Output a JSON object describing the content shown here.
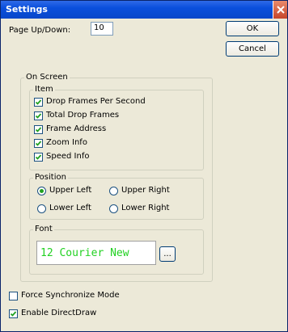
{
  "window": {
    "title": "Settings"
  },
  "page_updown": {
    "label": "Page Up/Down:",
    "value": "10"
  },
  "buttons": {
    "ok": "OK",
    "cancel": "Cancel",
    "font_browse": "..."
  },
  "on_screen": {
    "title": "On Screen",
    "item": {
      "title": "Item",
      "checkboxes": [
        {
          "label": "Drop Frames Per Second",
          "checked": true
        },
        {
          "label": "Total Drop Frames",
          "checked": true
        },
        {
          "label": "Frame Address",
          "checked": true
        },
        {
          "label": "Zoom Info",
          "checked": true
        },
        {
          "label": "Speed Info",
          "checked": true
        }
      ]
    },
    "position": {
      "title": "Position",
      "options": [
        {
          "label": "Upper Left",
          "selected": true
        },
        {
          "label": "Upper Right",
          "selected": false
        },
        {
          "label": "Lower Left",
          "selected": false
        },
        {
          "label": "Lower Right",
          "selected": false
        }
      ]
    },
    "font": {
      "title": "Font",
      "preview": "12 Courier New",
      "preview_color": "#22d122"
    }
  },
  "options": [
    {
      "label": "Force Synchronize Mode",
      "checked": false
    },
    {
      "label": "Enable DirectDraw",
      "checked": true
    }
  ]
}
